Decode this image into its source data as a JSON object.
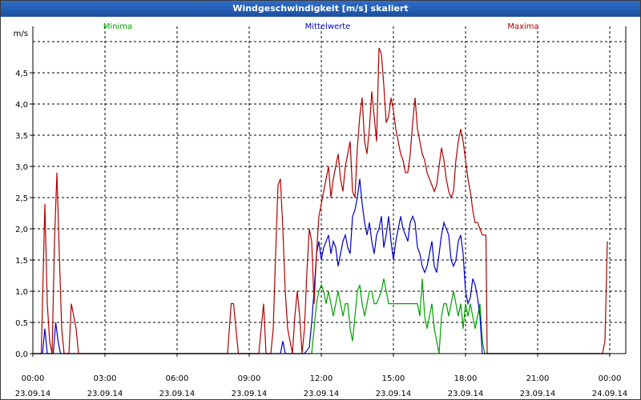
{
  "window": {
    "title": "Windgeschwindigkeit [m/s] skaliert"
  },
  "chart_data": {
    "type": "line",
    "title": "Windgeschwindigkeit [m/s] skaliert",
    "ylabel": "m/s",
    "xlabel": "",
    "ylim": [
      0,
      5.0
    ],
    "xlim": [
      0,
      24
    ],
    "grid": true,
    "legend": "top",
    "y_ticks": [
      "0,0",
      "0,5",
      "1,0",
      "1,5",
      "2,0",
      "2,5",
      "3,0",
      "3,5",
      "4,0",
      "4,5"
    ],
    "x_ticks": [
      {
        "x": 0,
        "time": "00:00",
        "date": "23.09.14"
      },
      {
        "x": 3,
        "time": "03:00",
        "date": "23.09.14"
      },
      {
        "x": 6,
        "time": "06:00",
        "date": "23.09.14"
      },
      {
        "x": 9,
        "time": "09:00",
        "date": "23.09.14"
      },
      {
        "x": 12,
        "time": "12:00",
        "date": "23.09.14"
      },
      {
        "x": 15,
        "time": "15:00",
        "date": "23.09.14"
      },
      {
        "x": 18,
        "time": "18:00",
        "date": "23.09.14"
      },
      {
        "x": 21,
        "time": "21:00",
        "date": "23.09.14"
      },
      {
        "x": 24,
        "time": "00:00",
        "date": "24.09.14"
      }
    ],
    "series": [
      {
        "name": "Minima",
        "color": "#00a000",
        "points": [
          [
            0,
            0
          ],
          [
            11.6,
            0
          ],
          [
            11.7,
            0.4
          ],
          [
            11.8,
            0.8
          ],
          [
            11.9,
            1.0
          ],
          [
            12.0,
            1.1
          ],
          [
            12.1,
            1.0
          ],
          [
            12.2,
            0.8
          ],
          [
            12.3,
            1.0
          ],
          [
            12.4,
            0.8
          ],
          [
            12.5,
            0.6
          ],
          [
            12.6,
            0.8
          ],
          [
            12.7,
            1.0
          ],
          [
            12.8,
            0.8
          ],
          [
            12.9,
            0.6
          ],
          [
            13.0,
            0.8
          ],
          [
            13.1,
            0.8
          ],
          [
            13.2,
            0.4
          ],
          [
            13.3,
            0.2
          ],
          [
            13.4,
            0.6
          ],
          [
            13.5,
            1.0
          ],
          [
            13.6,
            1.1
          ],
          [
            13.7,
            0.8
          ],
          [
            13.8,
            0.6
          ],
          [
            13.9,
            0.8
          ],
          [
            14.0,
            1.0
          ],
          [
            14.1,
            1.0
          ],
          [
            14.2,
            0.8
          ],
          [
            14.3,
            0.8
          ],
          [
            14.4,
            0.9
          ],
          [
            14.5,
            1.0
          ],
          [
            14.6,
            1.2
          ],
          [
            14.7,
            1.0
          ],
          [
            14.8,
            0.8
          ],
          [
            14.9,
            0.8
          ],
          [
            15.0,
            0.8
          ],
          [
            15.1,
            0.8
          ],
          [
            15.2,
            0.8
          ],
          [
            15.3,
            0.8
          ],
          [
            15.4,
            0.8
          ],
          [
            15.5,
            0.8
          ],
          [
            15.6,
            0.8
          ],
          [
            15.7,
            0.8
          ],
          [
            15.8,
            0.8
          ],
          [
            15.9,
            0.8
          ],
          [
            16.0,
            0.8
          ],
          [
            16.1,
            0.6
          ],
          [
            16.2,
            1.2
          ],
          [
            16.3,
            0.6
          ],
          [
            16.4,
            0.4
          ],
          [
            16.5,
            0.6
          ],
          [
            16.6,
            0.8
          ],
          [
            16.7,
            0.4
          ],
          [
            16.8,
            0.2
          ],
          [
            16.9,
            0.0
          ],
          [
            17.0,
            0.6
          ],
          [
            17.1,
            0.8
          ],
          [
            17.2,
            0.8
          ],
          [
            17.3,
            0.6
          ],
          [
            17.4,
            0.8
          ],
          [
            17.5,
            1.0
          ],
          [
            17.6,
            0.8
          ],
          [
            17.7,
            0.6
          ],
          [
            17.8,
            0.8
          ],
          [
            17.9,
            0.4
          ],
          [
            18.0,
            0.8
          ],
          [
            18.1,
            0.6
          ],
          [
            18.2,
            0.8
          ],
          [
            18.3,
            0.6
          ],
          [
            18.4,
            0.4
          ],
          [
            18.5,
            0.6
          ],
          [
            18.6,
            0.8
          ],
          [
            18.7,
            0.2
          ],
          [
            18.8,
            0.0
          ],
          [
            18.9,
            0.0
          ],
          [
            24,
            0
          ]
        ]
      },
      {
        "name": "Mittelwerte",
        "color": "#0000c0",
        "points": [
          [
            0,
            0
          ],
          [
            0.4,
            0
          ],
          [
            0.5,
            0.4
          ],
          [
            0.6,
            0.0
          ],
          [
            0.85,
            0.0
          ],
          [
            0.95,
            0.5
          ],
          [
            1.05,
            0.2
          ],
          [
            1.15,
            0.0
          ],
          [
            10.3,
            0.0
          ],
          [
            10.4,
            0.2
          ],
          [
            10.5,
            0.0
          ],
          [
            10.7,
            0.0
          ],
          [
            11.0,
            0.0
          ],
          [
            11.3,
            0.0
          ],
          [
            11.5,
            0.1
          ],
          [
            11.6,
            0.5
          ],
          [
            11.7,
            1.0
          ],
          [
            11.8,
            1.6
          ],
          [
            11.9,
            1.8
          ],
          [
            12.0,
            1.5
          ],
          [
            12.1,
            1.7
          ],
          [
            12.2,
            1.8
          ],
          [
            12.3,
            1.9
          ],
          [
            12.4,
            1.6
          ],
          [
            12.5,
            1.8
          ],
          [
            12.6,
            1.7
          ],
          [
            12.7,
            1.4
          ],
          [
            12.8,
            1.6
          ],
          [
            12.9,
            1.8
          ],
          [
            13.0,
            1.9
          ],
          [
            13.1,
            1.7
          ],
          [
            13.2,
            1.6
          ],
          [
            13.3,
            2.2
          ],
          [
            13.4,
            2.3
          ],
          [
            13.5,
            2.5
          ],
          [
            13.6,
            2.8
          ],
          [
            13.7,
            2.4
          ],
          [
            13.8,
            2.1
          ],
          [
            13.9,
            1.9
          ],
          [
            14.0,
            2.1
          ],
          [
            14.1,
            1.8
          ],
          [
            14.2,
            1.6
          ],
          [
            14.3,
            1.9
          ],
          [
            14.4,
            2.0
          ],
          [
            14.5,
            2.2
          ],
          [
            14.6,
            1.7
          ],
          [
            14.7,
            1.9
          ],
          [
            14.8,
            2.2
          ],
          [
            14.9,
            1.8
          ],
          [
            15.0,
            1.5
          ],
          [
            15.1,
            1.8
          ],
          [
            15.2,
            2.0
          ],
          [
            15.3,
            2.2
          ],
          [
            15.4,
            2.0
          ],
          [
            15.5,
            1.9
          ],
          [
            15.6,
            1.8
          ],
          [
            15.7,
            2.1
          ],
          [
            15.8,
            2.2
          ],
          [
            15.9,
            2.1
          ],
          [
            16.0,
            1.7
          ],
          [
            16.1,
            1.6
          ],
          [
            16.2,
            1.4
          ],
          [
            16.3,
            1.3
          ],
          [
            16.4,
            1.4
          ],
          [
            16.5,
            1.6
          ],
          [
            16.6,
            1.8
          ],
          [
            16.7,
            1.4
          ],
          [
            16.8,
            1.3
          ],
          [
            16.9,
            1.6
          ],
          [
            17.0,
            1.9
          ],
          [
            17.1,
            2.1
          ],
          [
            17.2,
            2.0
          ],
          [
            17.3,
            1.9
          ],
          [
            17.4,
            1.5
          ],
          [
            17.5,
            1.4
          ],
          [
            17.6,
            1.5
          ],
          [
            17.7,
            1.8
          ],
          [
            17.8,
            1.9
          ],
          [
            17.9,
            1.6
          ],
          [
            18.0,
            1.0
          ],
          [
            18.1,
            0.8
          ],
          [
            18.2,
            0.9
          ],
          [
            18.3,
            1.2
          ],
          [
            18.4,
            1.1
          ],
          [
            18.5,
            0.9
          ],
          [
            18.6,
            0.6
          ],
          [
            18.7,
            0.0
          ],
          [
            18.8,
            0.0
          ],
          [
            24,
            0
          ]
        ]
      },
      {
        "name": "Maxima",
        "color": "#b00000",
        "points": [
          [
            0,
            0
          ],
          [
            0.35,
            0
          ],
          [
            0.5,
            2.4
          ],
          [
            0.6,
            0.8
          ],
          [
            0.7,
            0.2
          ],
          [
            0.8,
            0.0
          ],
          [
            0.9,
            1.8
          ],
          [
            1.0,
            2.9
          ],
          [
            1.1,
            1.6
          ],
          [
            1.2,
            0.4
          ],
          [
            1.3,
            0.0
          ],
          [
            1.5,
            0.0
          ],
          [
            1.6,
            0.8
          ],
          [
            1.7,
            0.6
          ],
          [
            1.8,
            0.4
          ],
          [
            1.9,
            0.0
          ],
          [
            8.1,
            0.0
          ],
          [
            8.25,
            0.8
          ],
          [
            8.35,
            0.8
          ],
          [
            8.45,
            0.4
          ],
          [
            8.55,
            0.0
          ],
          [
            9.4,
            0.0
          ],
          [
            9.5,
            0.4
          ],
          [
            9.6,
            0.8
          ],
          [
            9.7,
            0.0
          ],
          [
            9.9,
            0.0
          ],
          [
            10.0,
            0.4
          ],
          [
            10.1,
            1.6
          ],
          [
            10.2,
            2.7
          ],
          [
            10.3,
            2.8
          ],
          [
            10.4,
            2.0
          ],
          [
            10.5,
            1.0
          ],
          [
            10.6,
            0.4
          ],
          [
            10.7,
            0.2
          ],
          [
            10.8,
            0.0
          ],
          [
            10.9,
            0.6
          ],
          [
            11.0,
            1.0
          ],
          [
            11.1,
            0.6
          ],
          [
            11.2,
            0.0
          ],
          [
            11.3,
            0.4
          ],
          [
            11.4,
            1.3
          ],
          [
            11.5,
            2.0
          ],
          [
            11.6,
            1.8
          ],
          [
            11.7,
            0.8
          ],
          [
            11.8,
            1.6
          ],
          [
            11.9,
            2.2
          ],
          [
            12.0,
            2.4
          ],
          [
            12.1,
            2.6
          ],
          [
            12.2,
            2.8
          ],
          [
            12.3,
            3.0
          ],
          [
            12.4,
            2.5
          ],
          [
            12.5,
            2.8
          ],
          [
            12.6,
            3.0
          ],
          [
            12.7,
            3.2
          ],
          [
            12.8,
            2.8
          ],
          [
            12.9,
            2.6
          ],
          [
            13.0,
            3.0
          ],
          [
            13.1,
            3.2
          ],
          [
            13.2,
            3.4
          ],
          [
            13.3,
            2.6
          ],
          [
            13.4,
            2.5
          ],
          [
            13.5,
            3.3
          ],
          [
            13.6,
            3.8
          ],
          [
            13.7,
            4.1
          ],
          [
            13.8,
            3.4
          ],
          [
            13.9,
            3.2
          ],
          [
            14.0,
            3.6
          ],
          [
            14.1,
            4.2
          ],
          [
            14.2,
            3.8
          ],
          [
            14.3,
            3.4
          ],
          [
            14.4,
            4.9
          ],
          [
            14.5,
            4.8
          ],
          [
            14.6,
            4.3
          ],
          [
            14.7,
            3.7
          ],
          [
            14.8,
            3.8
          ],
          [
            14.9,
            4.1
          ],
          [
            15.0,
            3.9
          ],
          [
            15.1,
            3.6
          ],
          [
            15.2,
            3.4
          ],
          [
            15.3,
            3.2
          ],
          [
            15.4,
            3.1
          ],
          [
            15.5,
            2.9
          ],
          [
            15.6,
            2.9
          ],
          [
            15.7,
            3.2
          ],
          [
            15.8,
            3.7
          ],
          [
            15.9,
            4.1
          ],
          [
            16.0,
            3.6
          ],
          [
            16.1,
            3.4
          ],
          [
            16.2,
            3.2
          ],
          [
            16.3,
            3.1
          ],
          [
            16.4,
            2.9
          ],
          [
            16.5,
            2.8
          ],
          [
            16.6,
            2.7
          ],
          [
            16.7,
            2.6
          ],
          [
            16.8,
            2.7
          ],
          [
            16.9,
            3.0
          ],
          [
            17.0,
            3.3
          ],
          [
            17.1,
            3.1
          ],
          [
            17.2,
            2.8
          ],
          [
            17.3,
            2.6
          ],
          [
            17.4,
            2.5
          ],
          [
            17.5,
            2.6
          ],
          [
            17.6,
            3.1
          ],
          [
            17.7,
            3.4
          ],
          [
            17.8,
            3.6
          ],
          [
            17.9,
            3.4
          ],
          [
            18.0,
            3.1
          ],
          [
            18.1,
            2.8
          ],
          [
            18.2,
            2.6
          ],
          [
            18.3,
            2.3
          ],
          [
            18.4,
            2.1
          ],
          [
            18.5,
            2.1
          ],
          [
            18.6,
            2.0
          ],
          [
            18.7,
            1.9
          ],
          [
            18.8,
            1.9
          ],
          [
            18.85,
            1.9
          ],
          [
            18.9,
            0.0
          ],
          [
            23.7,
            0.0
          ],
          [
            23.8,
            0.2
          ],
          [
            23.9,
            1.8
          ]
        ]
      }
    ]
  }
}
